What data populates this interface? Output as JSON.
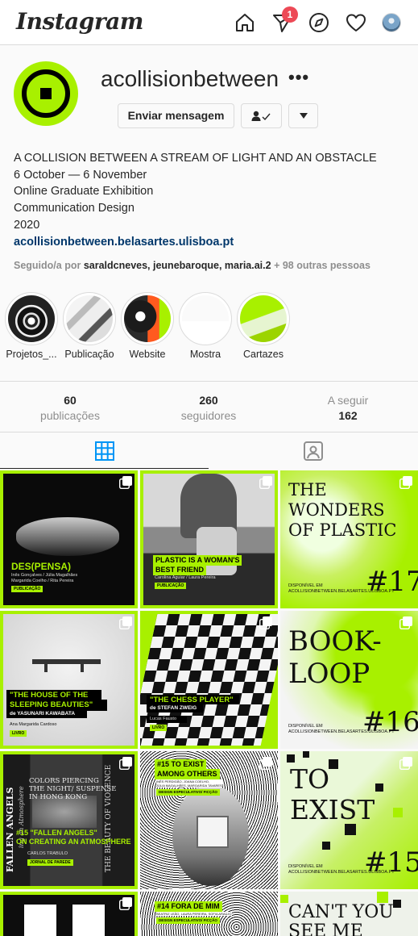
{
  "app": {
    "logo": "Instagram",
    "notification_count": "1"
  },
  "nav": {
    "icons": [
      "home-icon",
      "direct-icon",
      "explore-icon",
      "activity-heart-icon",
      "profile-avatar"
    ]
  },
  "profile": {
    "username": "acollisionbetween",
    "more": "•••",
    "message_button": "Enviar mensagem",
    "bio_lines": [
      "A COLLISION BETWEEN A STREAM OF LIGHT AND AN OBSTACLE",
      "6 October — 6 November",
      "Online Graduate Exhibition",
      "Communication Design",
      "2020"
    ],
    "link": "acollisionbetween.belasartes.ulisboa.pt",
    "followed_prefix": "Seguido/a por",
    "followed_names": "saraldcneves, jeunebaroque, maria.ai.2",
    "followed_suffix": "+ 98 outras pessoas"
  },
  "highlights": [
    {
      "label": "Projetos_..."
    },
    {
      "label": "Publicação"
    },
    {
      "label": "Website"
    },
    {
      "label": "Mostra"
    },
    {
      "label": "Cartazes"
    }
  ],
  "stats": {
    "posts_count": "60",
    "posts_label": "publicações",
    "followers_count": "260",
    "followers_label": "seguidores",
    "following_label": "A seguir",
    "following_count": "162"
  },
  "posts": {
    "p1": {
      "title": "DES(PENSA)",
      "authors": "Inês Gonçalves / Júlia Magalhães\nMargarida Coelho / Rita Pereira",
      "tag": "PUBLICAÇÃO"
    },
    "p2": {
      "title_1": "PLASTIC IS A WOMAN'S",
      "title_2": "BEST FRIEND",
      "authors": "Carolina Aguiar / Laura Pereira",
      "tag": "PUBLICAÇÃO"
    },
    "p3": {
      "line1": "THE",
      "line2": "WONDERS",
      "line3": "OF PLASTIC",
      "number": "#17",
      "small": "DISPONÍVEL EM\nACOLLISIONBETWEEN.BELASARTES.ULISBOA.PT"
    },
    "p4": {
      "title_1": "\"THE HOUSE OF THE",
      "title_2": "SLEEPING BEAUTIES\"",
      "subtitle": "de YASUNARI KAWABATA",
      "author": "Ana Margarida Cardoso",
      "tag": "LIVRO"
    },
    "p5": {
      "title": "\"THE CHESS PLAYER\"",
      "subtitle": "de STEFAN ZWEIG",
      "author": "Lucas Fausto",
      "tag": "LIVRO"
    },
    "p6": {
      "line1": "BOOK-",
      "line2": "LOOP",
      "number": "#16",
      "small": "DISPONÍVEL EM\nACOLLISIONBETWEEN.BELASARTES.ULISBOA.PT"
    },
    "p7": {
      "heading_1": "COLORS PIERCING",
      "heading_2": "THE NIGHT/ SUSPENSE",
      "heading_3": "IN HONG KONG",
      "side": "FALLEN ANGELS",
      "side2": "ing an Atmosphere",
      "title_1": "#15 \"FALLEN ANGELS\"",
      "title_2": "ON CREATING AN ATMOSPHERE",
      "author": "CARLOS TRABULO",
      "tag": "JORNAL DE PAREDE",
      "right": "THE BEAUTY OF VIOLENCE"
    },
    "p8": {
      "title_1": "#15 TO EXIST",
      "title_2": "AMONG OTHERS",
      "authors": "INÊS PERDIGÃO, JOANA COELHO,\nJÚLIA MAGALHÃES, MARGARIDA TAVARES",
      "tag": "DESIGN ESPECULATIVO/ FICÇÃO"
    },
    "p9": {
      "line1": "TO",
      "line2": "EXIST",
      "number": "#15",
      "small": "DISPONÍVEL EM\nACOLLISIONBETWEEN.BELASARTES.ULISBOA.PT"
    },
    "p11": {
      "title": "#14 FORA DE MIM",
      "authors": "BEATRIZ LEÃO, LAURA PEREIRA, SOFIA ARAÚJO",
      "tag": "DESIGN ESPECULATIVO/ FICÇÃO"
    },
    "p12": {
      "line1": "CAN'T YOU",
      "line2": "SEE ME"
    }
  },
  "colors": {
    "accent_green": "#a8f000",
    "link_blue": "#00376b",
    "badge_red": "#ed4956"
  }
}
